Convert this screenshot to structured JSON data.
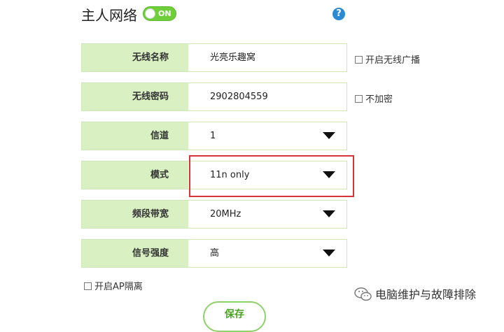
{
  "header": {
    "title": "主人网络",
    "toggle_label": "ON",
    "help_glyph": "?"
  },
  "rows": [
    {
      "label": "无线名称",
      "value": "光亮乐趣窝"
    },
    {
      "label": "无线密码",
      "value": "2902804559"
    },
    {
      "label": "信道",
      "value": "1"
    },
    {
      "label": "模式",
      "value": "11n only"
    },
    {
      "label": "频段带宽",
      "value": "20MHz"
    },
    {
      "label": "信号强度",
      "value": "高"
    }
  ],
  "options": {
    "broadcast": "开启无线广播",
    "no_encrypt": "不加密",
    "ap_isolation": "开启AP隔离"
  },
  "save_label": "保存",
  "watermark": "电脑维护与故障排除",
  "colors": {
    "accent_green": "#6fcf3a",
    "label_bg": "#d8f0c2",
    "highlight": "#d9343a",
    "help_blue": "#2a8ad6"
  }
}
